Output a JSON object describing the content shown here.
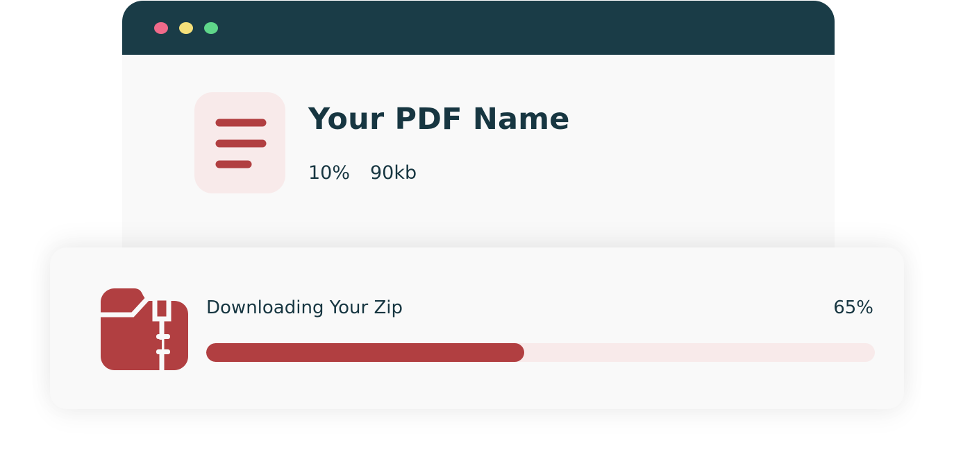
{
  "window": {
    "controls": [
      {
        "name": "close",
        "color": "#f06a8a"
      },
      {
        "name": "minimize",
        "color": "#f5e07a"
      },
      {
        "name": "maximize",
        "color": "#5fd68a"
      }
    ]
  },
  "file": {
    "icon": "document-lines-icon",
    "title": "Your PDF Name",
    "percent": "10%",
    "size": "90kb"
  },
  "download": {
    "icon": "zip-folder-icon",
    "label": "Downloading Your Zip",
    "percent_label": "65%",
    "progress_fraction": 0.476
  },
  "colors": {
    "header": "#1a3c47",
    "accent": "#b13f41",
    "accent_light": "#f8eaea",
    "text": "#173641"
  }
}
